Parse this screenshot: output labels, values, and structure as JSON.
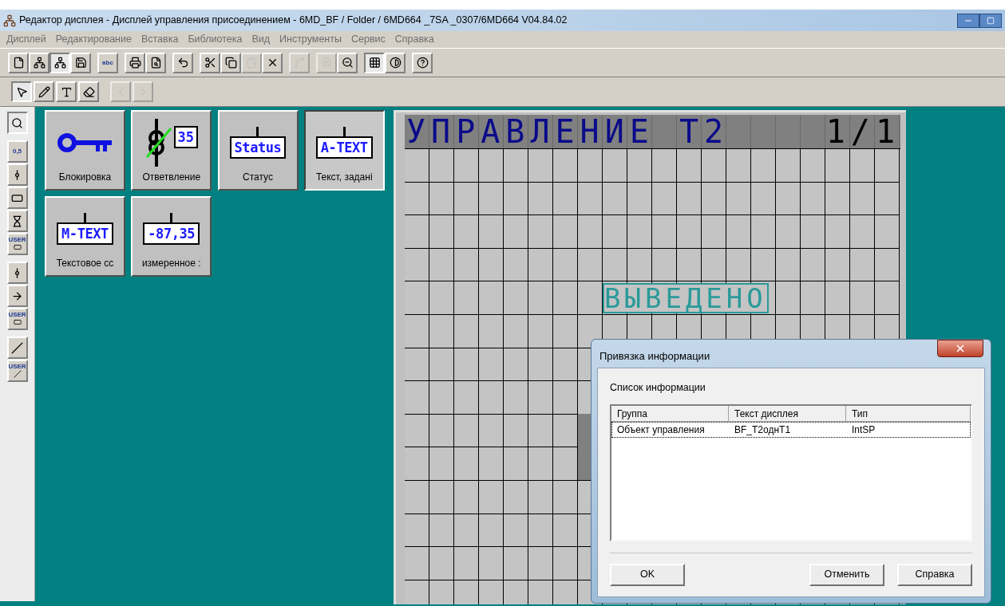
{
  "window": {
    "title": "Редактор дисплея - Дисплей управления присоединением - 6MD_BF / Folder / 6MD664 _7SA _0307/6MD664 V04.84.02"
  },
  "menu": [
    "Дисплей",
    "Редактирование",
    "Вставка",
    "Библиотека",
    "Вид",
    "Инструменты",
    "Сервис",
    "Справка"
  ],
  "toolbar_main": [
    [
      {
        "pressed": false,
        "disabled": false
      },
      {
        "pressed": false,
        "disabled": false
      },
      {
        "pressed": true,
        "disabled": false
      },
      {
        "pressed": false,
        "disabled": false
      }
    ],
    [
      {
        "pressed": false,
        "disabled": false,
        "label": "abc"
      }
    ],
    [
      {
        "pressed": false,
        "disabled": false
      },
      {
        "pressed": false,
        "disabled": false
      }
    ],
    [
      {
        "pressed": false,
        "disabled": false
      }
    ],
    [
      {
        "pressed": false,
        "disabled": false
      },
      {
        "pressed": false,
        "disabled": false
      },
      {
        "pressed": false,
        "disabled": true
      },
      {
        "pressed": false,
        "disabled": false
      }
    ],
    [
      {
        "pressed": false,
        "disabled": true
      }
    ],
    [
      {
        "pressed": false,
        "disabled": true
      },
      {
        "pressed": false,
        "disabled": false
      }
    ],
    [
      {
        "pressed": true,
        "disabled": false
      },
      {
        "pressed": false,
        "disabled": false
      }
    ],
    [
      {
        "pressed": false,
        "disabled": false
      }
    ]
  ],
  "toolbar_draw": [
    [
      {
        "pressed": true,
        "disabled": false
      },
      {
        "pressed": false,
        "disabled": false
      },
      {
        "pressed": false,
        "disabled": false
      },
      {
        "pressed": false,
        "disabled": false
      }
    ],
    [
      {
        "pressed": false,
        "disabled": true
      },
      {
        "pressed": false,
        "disabled": true
      }
    ]
  ],
  "side_toolbar": [
    [
      {
        "pressed": true
      }
    ],
    [
      {
        "pressed": false,
        "label": "0,5"
      },
      {
        "pressed": false
      },
      {
        "pressed": false
      },
      {
        "pressed": false
      },
      {
        "pressed": false,
        "label": "USER"
      }
    ],
    [
      {
        "pressed": false
      },
      {
        "pressed": false
      },
      {
        "pressed": false,
        "label": "USER"
      }
    ],
    [
      {
        "pressed": false
      },
      {
        "pressed": false,
        "label": "USER"
      }
    ]
  ],
  "palette": [
    {
      "kind": "key",
      "label": "Блокировка",
      "selected": false
    },
    {
      "kind": "tap",
      "label": "Ответвление",
      "icon_text": "35",
      "selected": false
    },
    {
      "kind": "box",
      "label": "Статус",
      "icon_text": "Status",
      "selected": false
    },
    {
      "kind": "box",
      "label": "Текст, задані",
      "icon_text": "A-TEXT",
      "selected": true
    },
    {
      "kind": "box",
      "label": "Текстовое сс",
      "icon_text": "M-TEXT",
      "selected": false
    },
    {
      "kind": "box",
      "label": "измеренное :",
      "icon_text": "-87,35",
      "selected": false
    }
  ],
  "display": {
    "title": "УПРАВЛЕНИЕ Т2",
    "page": "1/1",
    "element": "ВЫВЕДЕНО"
  },
  "dialog": {
    "title": "Привязка информации",
    "section": "Список информации",
    "columns": [
      "Группа",
      "Текст дисплея",
      "Тип"
    ],
    "rows": [
      {
        "cells": [
          "Объект управления",
          "BF_T2однT1",
          "IntSP"
        ],
        "selected": true
      }
    ],
    "buttons": [
      "OK",
      "Отменить",
      "Справка"
    ]
  }
}
